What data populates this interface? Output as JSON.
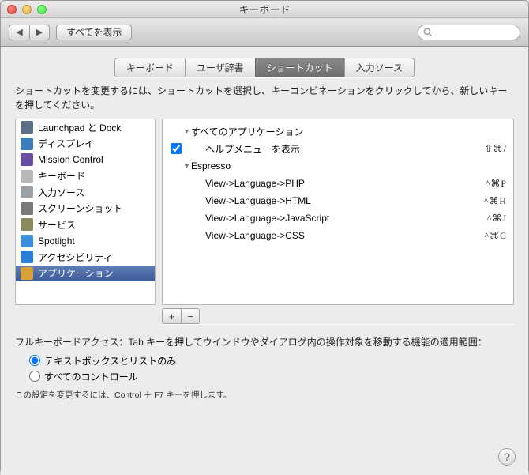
{
  "window": {
    "title": "キーボード"
  },
  "toolbar": {
    "back": "◀",
    "forward": "▶",
    "show_all": "すべてを表示",
    "search_placeholder": ""
  },
  "tabs": [
    {
      "label": "キーボード",
      "active": false
    },
    {
      "label": "ユーザ辞書",
      "active": false
    },
    {
      "label": "ショートカット",
      "active": true
    },
    {
      "label": "入力ソース",
      "active": false
    }
  ],
  "instruction": "ショートカットを変更するには、ショートカットを選択し、キーコンビネーションをクリックしてから、新しいキーを押してください。",
  "sidebar": [
    {
      "label": "Launchpad と Dock",
      "icon": "#5b6f86"
    },
    {
      "label": "ディスプレイ",
      "icon": "#3a7db8"
    },
    {
      "label": "Mission Control",
      "icon": "#6a4da0"
    },
    {
      "label": "キーボード",
      "icon": "#b8b8b8"
    },
    {
      "label": "入力ソース",
      "icon": "#9aa0a6"
    },
    {
      "label": "スクリーンショット",
      "icon": "#7a7a7a"
    },
    {
      "label": "サービス",
      "icon": "#8a8a5a"
    },
    {
      "label": "Spotlight",
      "icon": "#3a8fd8"
    },
    {
      "label": "アクセシビリティ",
      "icon": "#2a7ed8"
    },
    {
      "label": "アプリケーション",
      "icon": "#d8a23a",
      "selected": true
    }
  ],
  "shortcuts": {
    "groups": [
      {
        "name": "すべてのアプリケーション",
        "items": [
          {
            "label": "ヘルプメニューを表示",
            "keys": "⇧⌘/",
            "checked": true
          }
        ]
      },
      {
        "name": "Espresso",
        "items": [
          {
            "label": "View->Language->PHP",
            "keys": "^⌘P"
          },
          {
            "label": "View->Language->HTML",
            "keys": "^⌘H"
          },
          {
            "label": "View->Language->JavaScript",
            "keys": "^⌘J"
          },
          {
            "label": "View->Language->CSS",
            "keys": "^⌘C"
          }
        ]
      }
    ]
  },
  "buttons": {
    "add": "+",
    "remove": "−"
  },
  "full_keyboard": {
    "text": "フルキーボードアクセス：Tab キーを押してウインドウやダイアログ内の操作対象を移動する機能の適用範囲：",
    "options": [
      {
        "label": "テキストボックスとリストのみ",
        "checked": true
      },
      {
        "label": "すべてのコントロール",
        "checked": false
      }
    ],
    "hint": "この設定を変更するには、Control ＋ F7 キーを押します。"
  },
  "help": "?"
}
